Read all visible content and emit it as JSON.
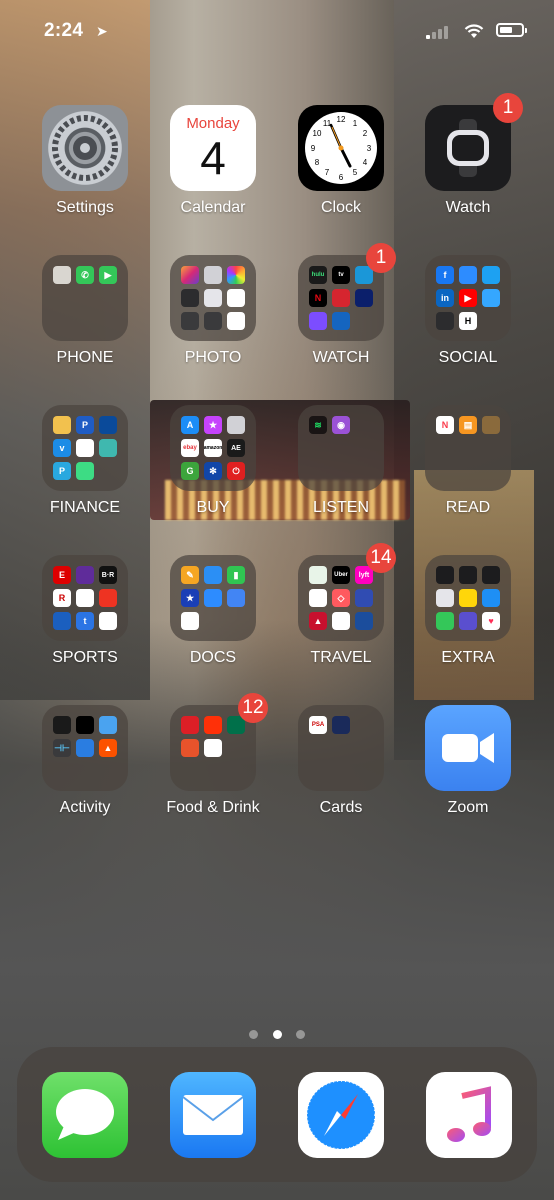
{
  "status_bar": {
    "time": "2:24",
    "location_icon": "location-arrow-icon",
    "signal_bars": 1,
    "wifi_icon": "wifi-icon",
    "battery_percent": 45
  },
  "apps": [
    {
      "id": "settings",
      "label": "Settings",
      "icon": "settings-gear-icon"
    },
    {
      "id": "calendar",
      "label": "Calendar",
      "icon": "calendar-icon",
      "day": "Monday",
      "date": "4"
    },
    {
      "id": "clock",
      "label": "Clock",
      "icon": "clock-icon"
    },
    {
      "id": "watch",
      "label": "Watch",
      "icon": "watch-icon",
      "badge": "1"
    }
  ],
  "folders": [
    {
      "label": "PHONE",
      "badge": ""
    },
    {
      "label": "PHOTO",
      "badge": ""
    },
    {
      "label": "WATCH",
      "badge": "1"
    },
    {
      "label": "SOCIAL",
      "badge": ""
    },
    {
      "label": "FINANCE",
      "badge": ""
    },
    {
      "label": "BUY",
      "badge": ""
    },
    {
      "label": "LISTEN",
      "badge": ""
    },
    {
      "label": "READ",
      "badge": ""
    },
    {
      "label": "SPORTS",
      "badge": ""
    },
    {
      "label": "DOCS",
      "badge": ""
    },
    {
      "label": "TRAVEL",
      "badge": "14"
    },
    {
      "label": "EXTRA",
      "badge": ""
    },
    {
      "label": "Activity",
      "badge": ""
    },
    {
      "label": "Food & Drink",
      "badge": "12"
    },
    {
      "label": "Cards",
      "badge": ""
    }
  ],
  "zoom": {
    "label": "Zoom",
    "icon": "video-camera-icon"
  },
  "page_indicator": {
    "pages": 3,
    "current": 2
  },
  "dock": [
    {
      "id": "messages",
      "icon": "speech-bubble-icon"
    },
    {
      "id": "mail",
      "icon": "envelope-icon"
    },
    {
      "id": "safari",
      "icon": "compass-icon"
    },
    {
      "id": "music",
      "icon": "music-note-icon"
    }
  ],
  "colors": {
    "badge_red": "#e8453c",
    "calendar_red": "#e8453c",
    "zoom_blue": "#3b82f0",
    "messages_green": "#2ec234",
    "mail_blue": "#1a78f2"
  }
}
